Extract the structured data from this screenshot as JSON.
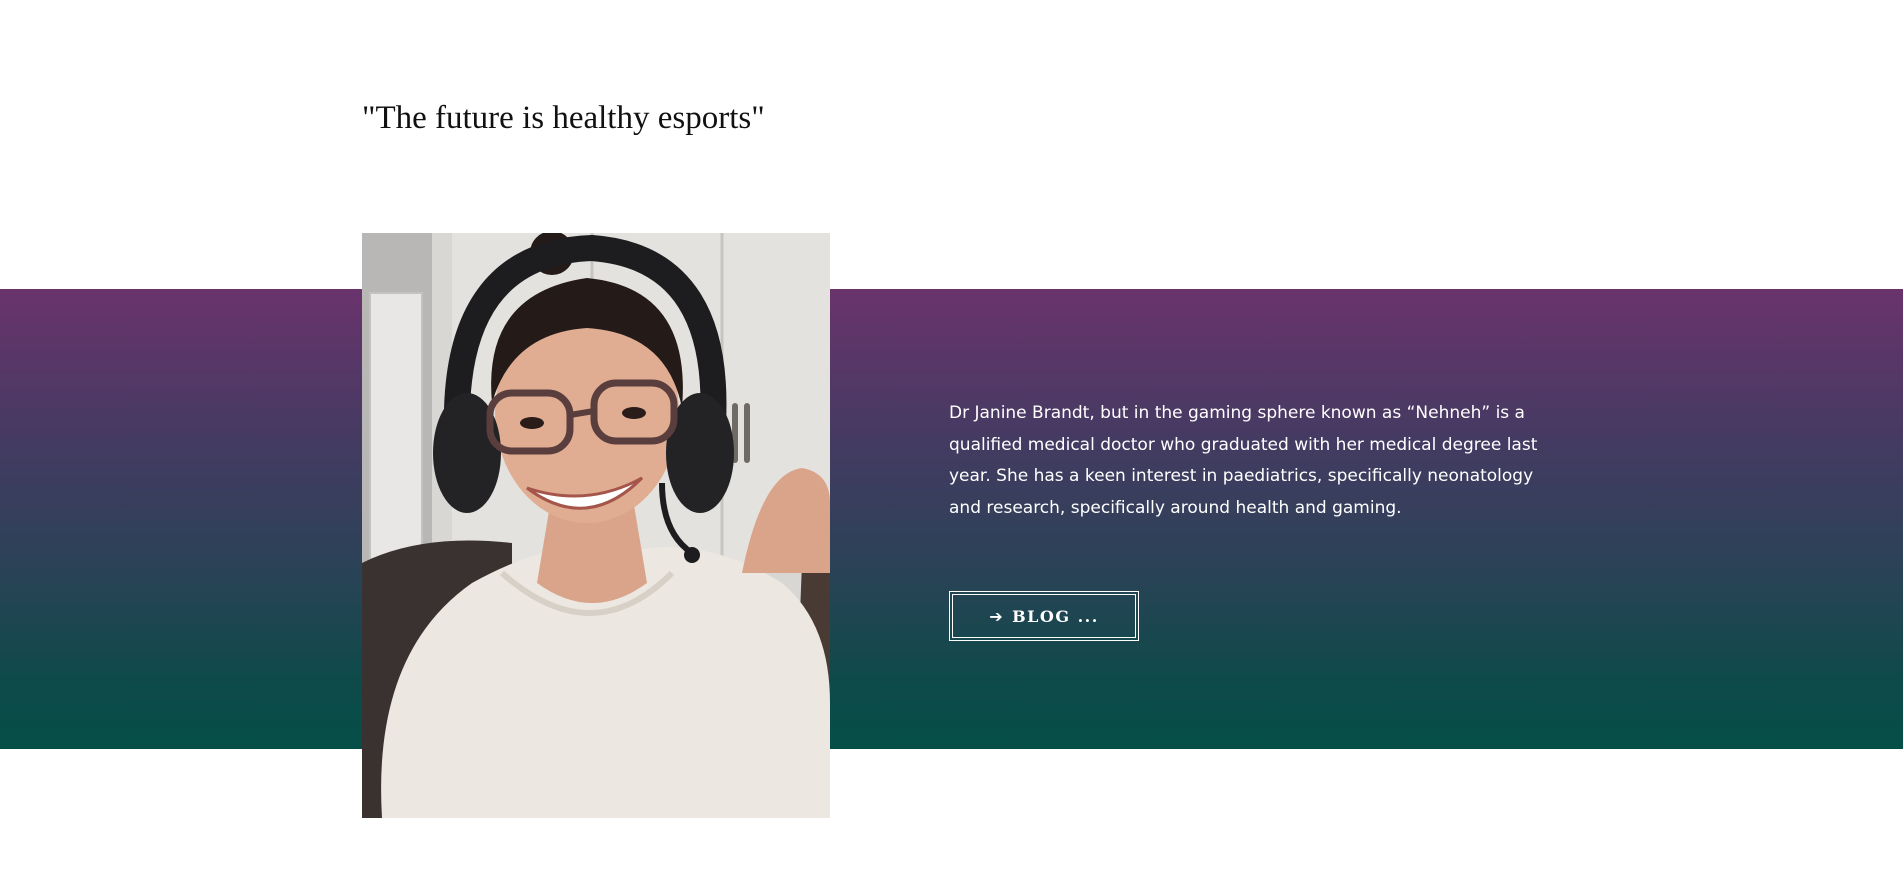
{
  "quote": {
    "heading": "\"The future is healthy esports\""
  },
  "profile": {
    "photo_alt": "Portrait of a smiling woman with glasses wearing a gaming headset",
    "bio": "Dr Janine Brandt, but in the gaming sphere known as “Nehneh” is a qualified medical doctor who graduated with her medical degree last year. She has a keen interest in paediatrics, specifically neonatology and research, specifically around health and gaming."
  },
  "blog_button": {
    "icon": "arrow-right-icon",
    "label": "BLOG ..."
  },
  "colors": {
    "band_top": "#6a336c",
    "band_bottom": "#054e47",
    "text_light": "#ffffff",
    "heading": "#111111"
  }
}
